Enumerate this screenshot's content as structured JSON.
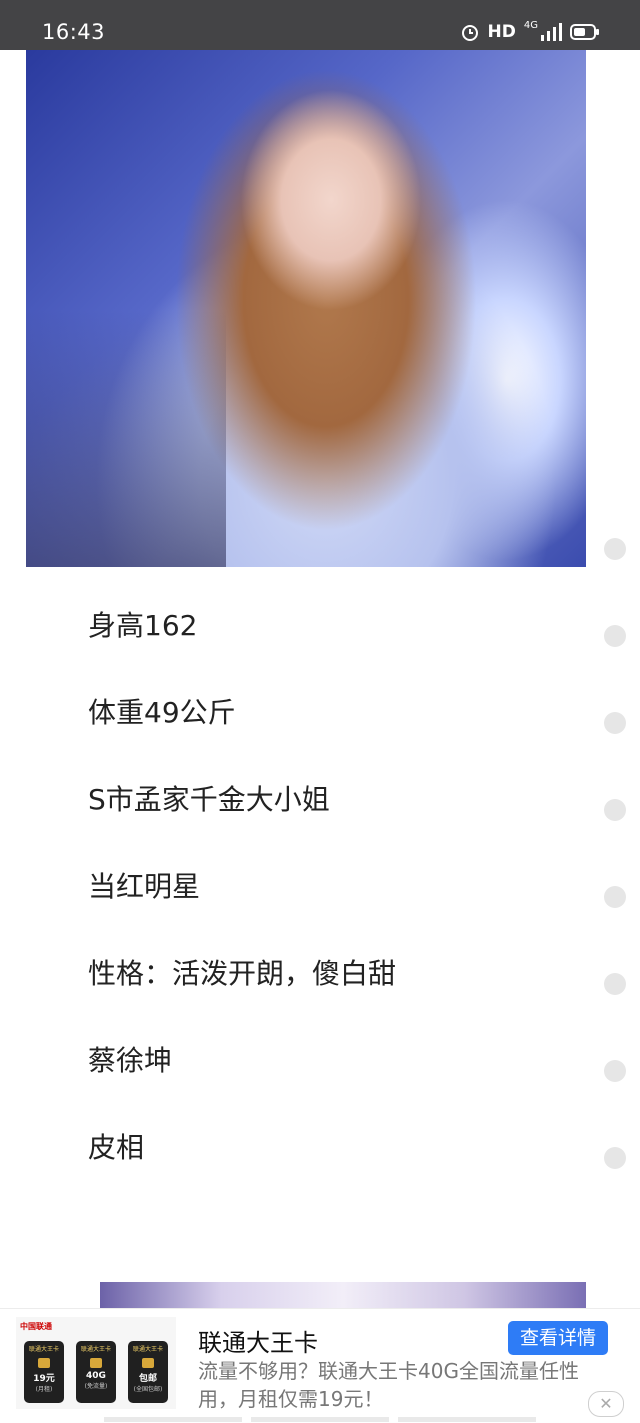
{
  "status_bar": {
    "time": "16:43",
    "hd": "HD",
    "network": "4G",
    "icons": [
      "alarm-icon",
      "signal-icon",
      "battery-icon"
    ]
  },
  "article": {
    "photo": "photo",
    "items": [
      "身高162",
      "体重49公斤",
      "S市孟家千金大小姐",
      "当红明星",
      "性格：活泼开朗，傻白甜",
      "蔡徐坤",
      "皮相"
    ]
  },
  "ad": {
    "title": "联通大王卡",
    "description": "流量不够用？联通大王卡40G全国流量任性用，月租仅需19元！",
    "button": "查看详情",
    "close": "✕",
    "thumb": {
      "logo": "中国联通",
      "cards": [
        {
          "title": "联通大王卡",
          "value": "19元",
          "sub": "(月租)"
        },
        {
          "title": "联通大王卡",
          "value": "40G",
          "sub": "(免流量)"
        },
        {
          "title": "联通大王卡",
          "value": "包邮",
          "sub": "(全国包邮)"
        }
      ]
    }
  }
}
